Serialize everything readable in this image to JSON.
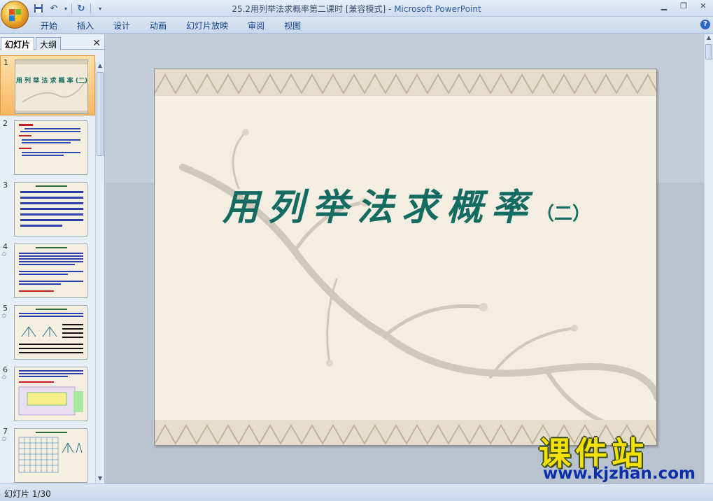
{
  "window": {
    "document_name": "25.2用列举法求概率第二课时 [兼容模式]",
    "separator": " - ",
    "app_name": "Microsoft PowerPoint"
  },
  "ribbon": {
    "tabs": [
      "开始",
      "插入",
      "设计",
      "动画",
      "幻灯片放映",
      "审阅",
      "视图"
    ]
  },
  "left_pane": {
    "tab_slides": "幻灯片",
    "tab_outline": "大纲",
    "close_glyph": "✕",
    "thumbnails": [
      {
        "number": "1",
        "star": "",
        "selected": true
      },
      {
        "number": "2",
        "star": "",
        "selected": false
      },
      {
        "number": "3",
        "star": "",
        "selected": false
      },
      {
        "number": "4",
        "star": "✩",
        "selected": false
      },
      {
        "number": "5",
        "star": "✩",
        "selected": false
      },
      {
        "number": "6",
        "star": "✩",
        "selected": false
      },
      {
        "number": "7",
        "star": "✩",
        "selected": false
      }
    ]
  },
  "slide": {
    "title": "用列举法求概率",
    "subtitle": "（二）",
    "colors": {
      "title": "#146b62",
      "background": "#f4eee2"
    }
  },
  "watermark": {
    "big": "课件站",
    "url": "www.kjzhan.com"
  },
  "status": {
    "slide_counter": "幻灯片 1/30"
  }
}
